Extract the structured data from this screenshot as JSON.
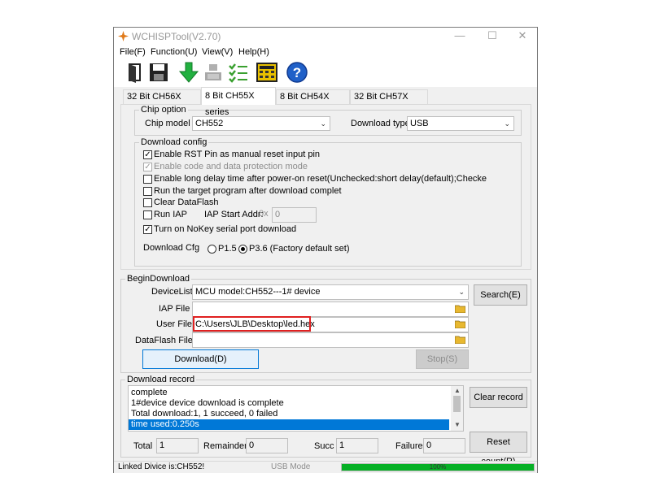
{
  "window": {
    "title": "WCHISPTool(V2.70)",
    "minimize": "—",
    "maximize": "☐",
    "close": "✕"
  },
  "menu": [
    "File(F)",
    "Function(U)",
    "View(V)",
    "Help(H)"
  ],
  "toolbar_icons": [
    "open-icon",
    "save-icon",
    "download-icon",
    "chip-icon",
    "checklist-icon",
    "calculator-icon",
    "help-icon"
  ],
  "tabs": [
    "32 Bit CH56X series",
    "8 Bit CH55X series",
    "8 Bit CH54X series",
    "32 Bit CH57X series"
  ],
  "active_tab": 1,
  "chip_option": {
    "label": "Chip option",
    "model_label": "Chip model",
    "model_value": "CH552",
    "download_type_label": "Download type",
    "download_type_value": "USB"
  },
  "download_config": {
    "label": "Download config",
    "options": [
      {
        "text": "Enable RST Pin as manual reset input pin",
        "checked": true,
        "disabled": false
      },
      {
        "text": "Enable code and data protection mode",
        "checked": true,
        "disabled": true
      },
      {
        "text": "Enable long delay time after power-on reset(Unchecked:short delay(default);Checke",
        "checked": false,
        "disabled": false
      },
      {
        "text": "Run the target program after download complet",
        "checked": false,
        "disabled": false
      },
      {
        "text": "Clear DataFlash",
        "checked": false,
        "disabled": false
      },
      {
        "text": "Run IAP",
        "checked": false,
        "disabled": false
      },
      {
        "text": "Turn on NoKey serial port download",
        "checked": true,
        "disabled": false
      }
    ],
    "iap_start_label": "IAP Start Addr:",
    "iap_prefix": "0x",
    "iap_value": "0",
    "cfg_label": "Download Cfg",
    "cfg_options": [
      "P1.5",
      "P3.6 (Factory default set)"
    ],
    "cfg_selected": 1
  },
  "begin_download": {
    "label": "BeginDownload",
    "device_list_label": "DeviceList",
    "device_list_value": "MCU model:CH552---1# device",
    "search_button": "Search(E)",
    "iap_file_label": "IAP File",
    "iap_file_value": "",
    "user_file_label": "User File",
    "user_file_value": "C:\\Users\\JLB\\Desktop\\led.hex",
    "dataflash_label": "DataFlash File",
    "dataflash_value": "",
    "download_button": "Download(D)",
    "stop_button": "Stop(S)"
  },
  "download_record": {
    "label": "Download record",
    "lines": [
      "complete",
      "1#device device download is complete",
      "Total download:1, 1 succeed, 0 failed",
      "time used:0.250s"
    ],
    "selected_line": 3,
    "clear_button": "Clear record",
    "reset_button": "Reset count(R)",
    "total_label": "Total",
    "total_value": "1",
    "remainder_label": "Remainder",
    "remainder_value": "0",
    "succ_label": "Succ",
    "succ_value": "1",
    "failure_label": "Failure",
    "failure_value": "0"
  },
  "status": {
    "linked": "Linked Divice is:CH552!",
    "mode": "USB Mode",
    "progress_text": "100%",
    "progress": 1.0
  },
  "colors": {
    "accent": "#0078d7",
    "highlight_box": "#e02020",
    "progress": "#06b025"
  }
}
